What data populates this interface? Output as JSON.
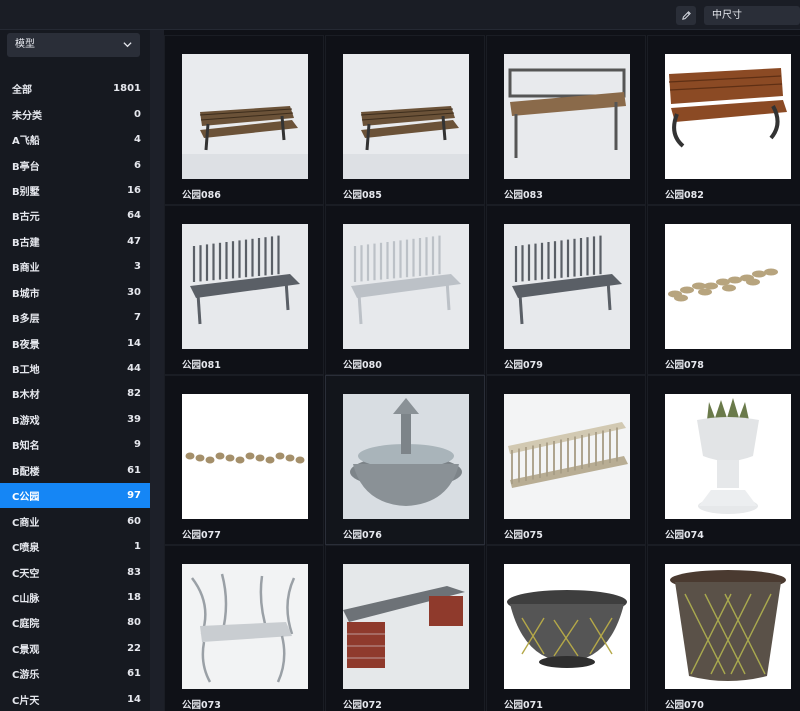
{
  "toolbar": {
    "size_select": "中尺寸"
  },
  "sidebar": {
    "filter": "模型",
    "categories": [
      {
        "label": "全部",
        "count": "1801"
      },
      {
        "label": "未分类",
        "count": "0"
      },
      {
        "label": "A飞船",
        "count": "4"
      },
      {
        "label": "B亭台",
        "count": "6"
      },
      {
        "label": "B别墅",
        "count": "16"
      },
      {
        "label": "B古元",
        "count": "64"
      },
      {
        "label": "B古建",
        "count": "47"
      },
      {
        "label": "B商业",
        "count": "3"
      },
      {
        "label": "B城市",
        "count": "30"
      },
      {
        "label": "B多层",
        "count": "7"
      },
      {
        "label": "B夜景",
        "count": "14"
      },
      {
        "label": "B工地",
        "count": "44"
      },
      {
        "label": "B木材",
        "count": "82"
      },
      {
        "label": "B游戏",
        "count": "39"
      },
      {
        "label": "B知名",
        "count": "9"
      },
      {
        "label": "B配楼",
        "count": "61"
      },
      {
        "label": "C公园",
        "count": "97"
      },
      {
        "label": "C商业",
        "count": "60"
      },
      {
        "label": "C喷泉",
        "count": "1"
      },
      {
        "label": "C天空",
        "count": "83"
      },
      {
        "label": "C山脉",
        "count": "18"
      },
      {
        "label": "C庭院",
        "count": "80"
      },
      {
        "label": "C景观",
        "count": "22"
      },
      {
        "label": "C游乐",
        "count": "61"
      },
      {
        "label": "C片天",
        "count": "14"
      }
    ],
    "active_index": 16
  },
  "grid": {
    "items": [
      {
        "label": "公园086",
        "icon": "wood-bench-icon"
      },
      {
        "label": "公园085",
        "icon": "wood-bench-icon"
      },
      {
        "label": "公园083",
        "icon": "metal-wood-bench-icon"
      },
      {
        "label": "公园082",
        "icon": "cast-iron-bench-icon"
      },
      {
        "label": "公园081",
        "icon": "metal-bench-icon"
      },
      {
        "label": "公园080",
        "icon": "white-metal-bench-icon"
      },
      {
        "label": "公园079",
        "icon": "metal-bench-icon"
      },
      {
        "label": "公园078",
        "icon": "stepping-stones-icon"
      },
      {
        "label": "公园077",
        "icon": "pebbles-icon"
      },
      {
        "label": "公园076",
        "icon": "lotus-fountain-icon"
      },
      {
        "label": "公园075",
        "icon": "fence-icon"
      },
      {
        "label": "公园074",
        "icon": "urn-planter-icon"
      },
      {
        "label": "公园073",
        "icon": "branch-bench-icon"
      },
      {
        "label": "公园072",
        "icon": "brick-bench-icon"
      },
      {
        "label": "公园071",
        "icon": "bowl-planter-icon"
      },
      {
        "label": "公园070",
        "icon": "basket-planter-icon"
      }
    ]
  }
}
